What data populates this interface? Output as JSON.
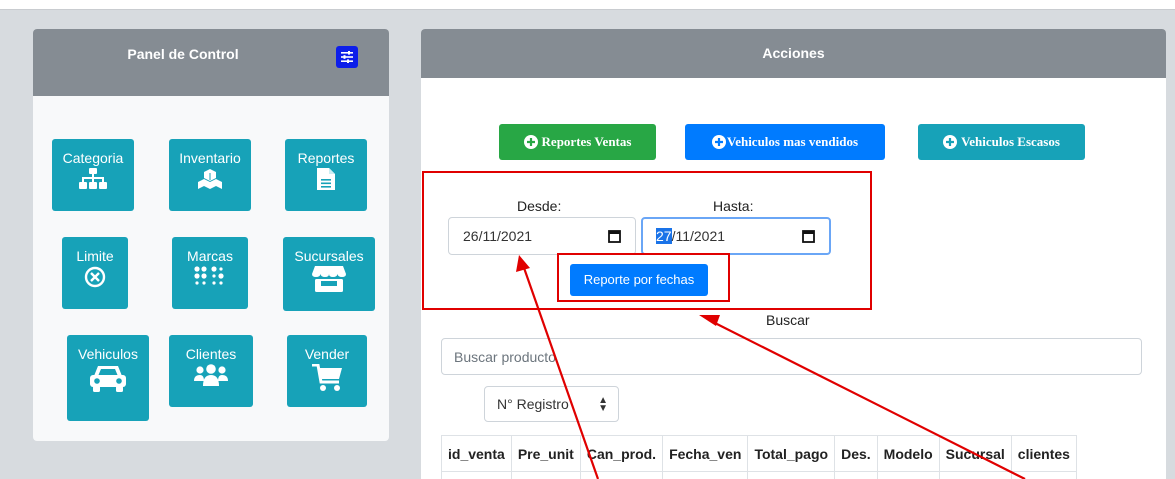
{
  "left_panel": {
    "title": "Panel de Control",
    "tiles": [
      {
        "label": "Categoria",
        "icon": "sitemap-icon"
      },
      {
        "label": "Inventario",
        "icon": "cubes-icon"
      },
      {
        "label": "Reportes",
        "icon": "file-icon"
      },
      {
        "label": "Limite",
        "icon": "times-circle-icon"
      },
      {
        "label": "Marcas",
        "icon": "braille-icon"
      },
      {
        "label": "Sucursales",
        "icon": "store-icon"
      },
      {
        "label": "Vehiculos",
        "icon": "car-icon"
      },
      {
        "label": "Clientes",
        "icon": "users-icon"
      },
      {
        "label": "Vender",
        "icon": "cart-icon"
      }
    ]
  },
  "right_panel": {
    "title": "Acciones",
    "buttons": {
      "reportes_ventas": "Reportes Ventas",
      "vehiculos_mas_vendidos": "Vehiculos mas vendidos",
      "vehiculos_escasos": "Vehiculos Escasos"
    },
    "desde_label": "Desde:",
    "hasta_label": "Hasta:",
    "desde_value": "26/11/2021",
    "hasta_day_selected": "27",
    "hasta_rest": "/11/2021",
    "report_button": "Reporte por fechas",
    "buscar_label": "Buscar",
    "search_placeholder": "Buscar producto",
    "select_value": "N° Registro",
    "table_headers": [
      "id_venta",
      "Pre_unit",
      "Can_prod.",
      "Fecha_ven",
      "Total_pago",
      "Des.",
      "Modelo",
      "Sucursal",
      "clientes"
    ]
  },
  "colors": {
    "header_gray": "#858c93",
    "teal": "#17a2b8",
    "green": "#28a745",
    "blue": "#007bff",
    "annotation_red": "#e00000"
  }
}
